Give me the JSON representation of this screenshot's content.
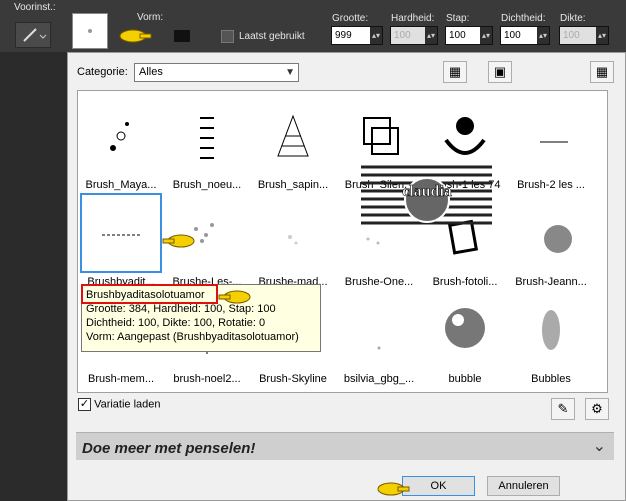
{
  "toolbar": {
    "preset_label": "Voorinst.:",
    "shape_label": "Vorm:",
    "recent_label": "Laatst gebruikt",
    "size": {
      "label": "Grootte:",
      "value": "999"
    },
    "hardness": {
      "label": "Hardheid:",
      "value": "100"
    },
    "step": {
      "label": "Stap:",
      "value": "100"
    },
    "density": {
      "label": "Dichtheid:",
      "value": "100"
    },
    "thickness": {
      "label": "Dikte:",
      "value": "100"
    }
  },
  "dialog": {
    "category_label": "Categorie:",
    "category_value": "Alles",
    "brushes": [
      [
        "Brush_Maya...",
        "Brush_noeu...",
        "Brush_sapin...",
        "Brush_Silen...",
        "Brush-1 les 74",
        "Brush-2 les ..."
      ],
      [
        "Brushbyadit...",
        "Brushe-Les-...",
        "Brushe-mad...",
        "Brushe-One...",
        "Brush-fotoli...",
        "Brush-Jeann..."
      ],
      [
        "Brush-mem...",
        "brush-noel2...",
        "Brush-Skyline",
        "bsilvia_gbg_...",
        "bubble",
        "Bubbles"
      ]
    ],
    "watermark_text": "claudia",
    "tooltip": {
      "title": "Brushbyaditasolotuamor",
      "line1": "Grootte: 384, Hardheid: 100, Stap: 100",
      "line2": "Dichtheid: 100, Dikte: 100, Rotatie: 0",
      "line3": "Vorm: Aangepast (Brushbyaditasolotuamor)"
    },
    "variation_label": "Variatie laden",
    "more_label": "Doe meer met penselen!",
    "ok_label": "OK",
    "cancel_label": "Annuleren"
  },
  "colors": {
    "accent": "#3b8fe0",
    "highlight": "#e01010",
    "tooltip_bg": "#ffffe1"
  }
}
